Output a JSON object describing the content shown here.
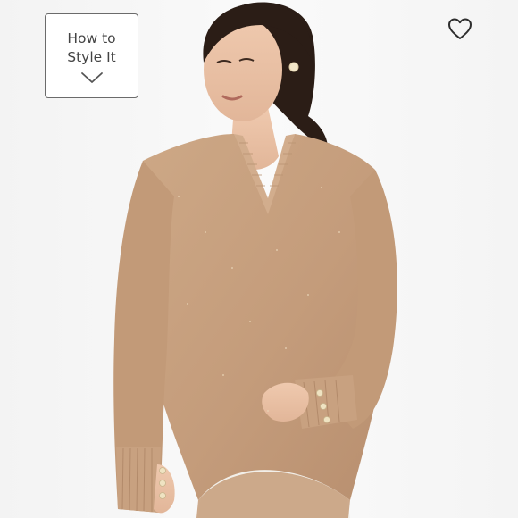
{
  "style_card": {
    "label": "How to Style It",
    "icon": "chevron-down-icon"
  },
  "favorite": {
    "icon": "heart-outline-icon"
  },
  "photo": {
    "icon": "product-photo",
    "colors": {
      "sweater": "#c9a283",
      "skin": "#e9c2a6",
      "hair": "#2b1d16",
      "pants": "#f2efe9",
      "background": "#f7f7f7"
    }
  }
}
